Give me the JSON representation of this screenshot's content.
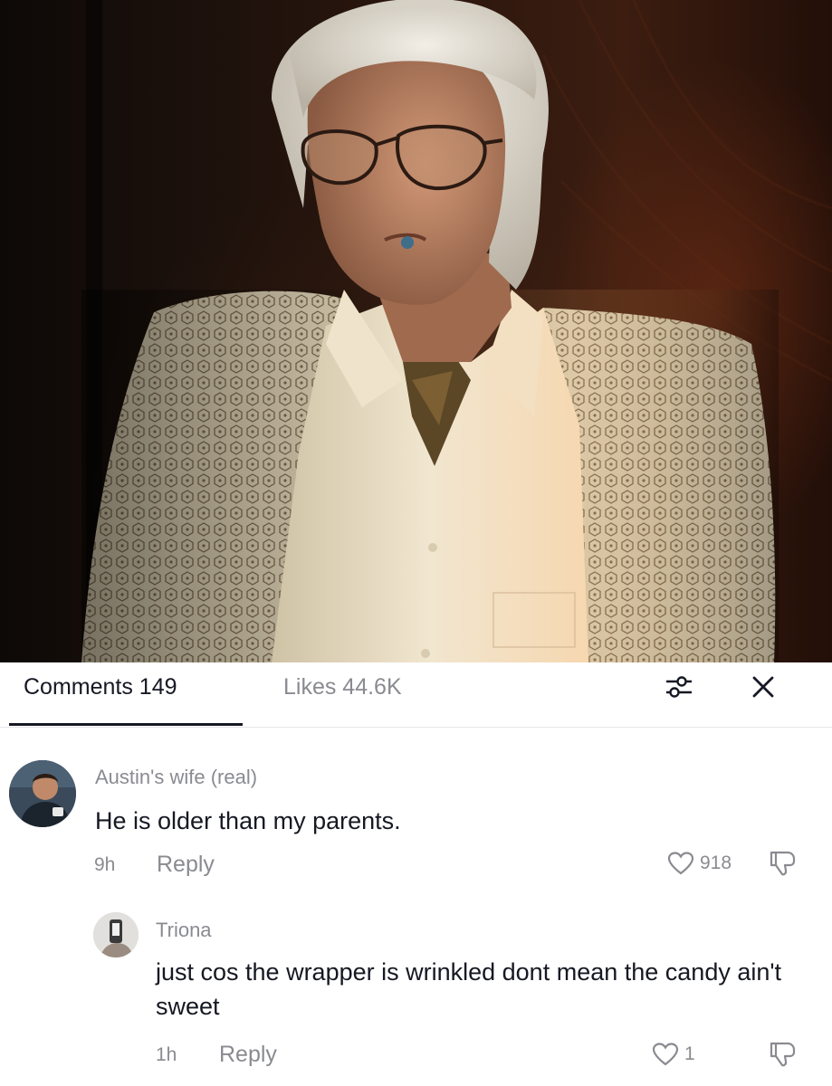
{
  "video": {
    "description_icon": "person-in-patterned-suit"
  },
  "tabs": {
    "comments_label": "Comments 149",
    "likes_label": "Likes 44.6K",
    "filter_icon": "sliders-icon",
    "close_icon": "close-icon"
  },
  "comments": [
    {
      "username": "Austin's wife (real)",
      "text": "He is older than my parents.",
      "time": "9h",
      "reply_label": "Reply",
      "likes": "918"
    }
  ],
  "replies": [
    {
      "username": "Triona",
      "text": "just cos the wrapper is wrinkled dont mean the candy ain't sweet",
      "time": "1h",
      "reply_label": "Reply",
      "likes": "1"
    }
  ],
  "colors": {
    "primary_text": "#161823",
    "secondary_text": "#8a8b91",
    "divider": "#e6e6e8",
    "background": "#ffffff"
  }
}
